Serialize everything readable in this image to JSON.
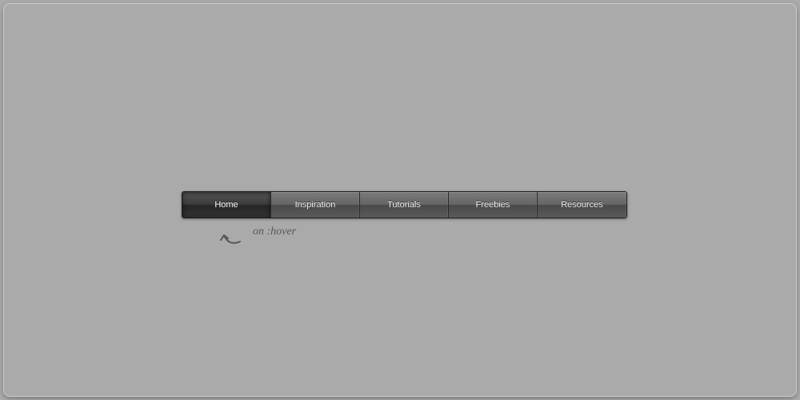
{
  "nav": {
    "items": [
      {
        "label": "Home",
        "active": true
      },
      {
        "label": "Inspiration",
        "active": false
      },
      {
        "label": "Tutorials",
        "active": false
      },
      {
        "label": "Freebies",
        "active": false
      },
      {
        "label": "Resources",
        "active": false
      }
    ]
  },
  "annotation": {
    "label": "on :hover"
  }
}
